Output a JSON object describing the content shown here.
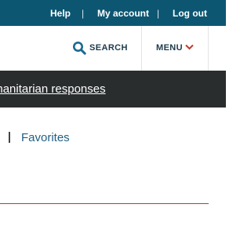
{
  "topbar": {
    "help": "Help",
    "separator": "|",
    "my_account": "My account",
    "log_out": "Log out"
  },
  "header": {
    "search_label": "SEARCH",
    "menu_label": "MENU"
  },
  "banner": {
    "link_text": "n humanitarian responses"
  },
  "tabs": {
    "favorites": "Favorites"
  },
  "colors": {
    "topbar_bg": "#0c5672",
    "banner_bg": "#2a2d2e",
    "link_blue": "#1f5f84",
    "accent_red": "#c0392b",
    "nav_text": "#1d3b4b"
  },
  "icons": {
    "search": "search-icon",
    "menu_chevron": "chevron-down-icon"
  }
}
